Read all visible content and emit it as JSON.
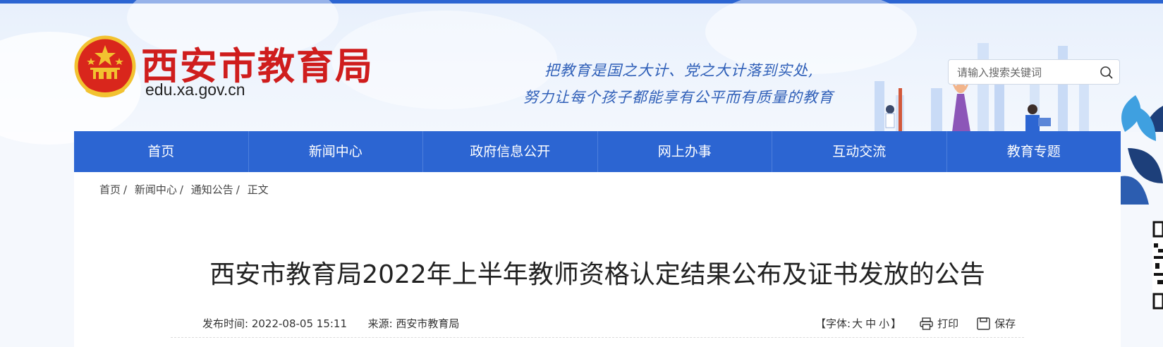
{
  "header": {
    "site_name": "西安市教育局",
    "domain": "edu.xa.gov.cn",
    "slogan_line1": "把教育是国之大计、党之大计落到实处,",
    "slogan_line2": "努力让每个孩子都能享有公平而有质量的教育",
    "search_placeholder": "请输入搜索关键词"
  },
  "nav": {
    "items": [
      "首页",
      "新闻中心",
      "政府信息公开",
      "网上办事",
      "互动交流",
      "教育专题"
    ]
  },
  "breadcrumb": {
    "items": [
      "首页",
      "新闻中心",
      "通知公告",
      "正文"
    ],
    "separator": "/"
  },
  "article": {
    "title": "西安市教育局2022年上半年教师资格认定结果公布及证书发放的公告",
    "publish_label": "发布时间:",
    "publish_time": "2022-08-05 15:11",
    "source_label": "来源:",
    "source": "西安市教育局",
    "font_size_label": "【字体:",
    "font_large": "大",
    "font_medium": "中",
    "font_small": "小",
    "font_size_close": "】",
    "print_label": "打印",
    "save_label": "保存"
  },
  "colors": {
    "brand_blue": "#2c65d2",
    "title_red": "#cf1d1d",
    "slogan_blue": "#2f5fb8"
  },
  "icons": [
    "national-emblem-icon",
    "search-icon",
    "print-icon",
    "save-icon",
    "qr-code-icon"
  ]
}
